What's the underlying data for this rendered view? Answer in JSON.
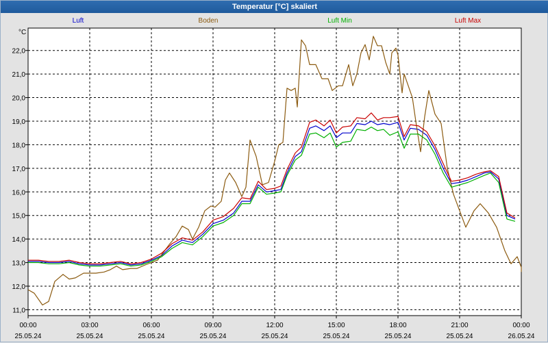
{
  "window": {
    "title": "Temperatur [°C] skaliert"
  },
  "colors": {
    "luft": "#0000cc",
    "boden": "#8b5a0f",
    "luft_min": "#00b000",
    "luft_max": "#c80000",
    "plot_bg": "#ffffff",
    "grid": "#000000"
  },
  "chart_data": {
    "type": "line",
    "title": "Temperatur [°C] skaliert",
    "ylabel": "°C",
    "xlabel": "",
    "ylim": [
      10.75,
      22.95
    ],
    "xlim_hours": [
      0,
      24
    ],
    "grid": true,
    "legend_placement": "top",
    "y_ticks": [
      "11,0",
      "12,0",
      "13,0",
      "14,0",
      "15,0",
      "16,0",
      "17,0",
      "18,0",
      "19,0",
      "20,0",
      "21,0",
      "22,0"
    ],
    "y_tick_values": [
      11,
      12,
      13,
      14,
      15,
      16,
      17,
      18,
      19,
      20,
      21,
      22
    ],
    "x_ticks": [
      {
        "time": "00:00",
        "date": "25.05.24",
        "hour": 0
      },
      {
        "time": "03:00",
        "date": "25.05.24",
        "hour": 3
      },
      {
        "time": "06:00",
        "date": "25.05.24",
        "hour": 6
      },
      {
        "time": "09:00",
        "date": "25.05.24",
        "hour": 9
      },
      {
        "time": "12:00",
        "date": "25.05.24",
        "hour": 12
      },
      {
        "time": "15:00",
        "date": "25.05.24",
        "hour": 15
      },
      {
        "time": "18:00",
        "date": "25.05.24",
        "hour": 18
      },
      {
        "time": "21:00",
        "date": "25.05.24",
        "hour": 21
      },
      {
        "time": "00:00",
        "date": "26.05.24",
        "hour": 24
      }
    ],
    "series": [
      {
        "name": "Luft",
        "color": "#0000cc",
        "points": [
          [
            0,
            13.05
          ],
          [
            0.5,
            13.05
          ],
          [
            1,
            13.0
          ],
          [
            1.5,
            13.0
          ],
          [
            2,
            13.05
          ],
          [
            2.5,
            12.95
          ],
          [
            3,
            12.9
          ],
          [
            3.5,
            12.9
          ],
          [
            4,
            12.95
          ],
          [
            4.5,
            13.0
          ],
          [
            5,
            12.9
          ],
          [
            5.5,
            12.95
          ],
          [
            6,
            13.1
          ],
          [
            6.5,
            13.3
          ],
          [
            7,
            13.7
          ],
          [
            7.5,
            13.95
          ],
          [
            8,
            13.85
          ],
          [
            8.5,
            14.2
          ],
          [
            9,
            14.65
          ],
          [
            9.5,
            14.8
          ],
          [
            10,
            15.1
          ],
          [
            10.4,
            15.6
          ],
          [
            10.8,
            15.6
          ],
          [
            11.2,
            16.3
          ],
          [
            11.6,
            16.0
          ],
          [
            12,
            16.05
          ],
          [
            12.3,
            16.1
          ],
          [
            12.6,
            16.8
          ],
          [
            13,
            17.5
          ],
          [
            13.3,
            17.7
          ],
          [
            13.7,
            18.7
          ],
          [
            14,
            18.8
          ],
          [
            14.4,
            18.6
          ],
          [
            14.7,
            18.8
          ],
          [
            15,
            18.3
          ],
          [
            15.3,
            18.5
          ],
          [
            15.7,
            18.5
          ],
          [
            16,
            18.9
          ],
          [
            16.4,
            18.85
          ],
          [
            16.7,
            19.0
          ],
          [
            17,
            18.85
          ],
          [
            17.3,
            18.9
          ],
          [
            17.6,
            18.85
          ],
          [
            18,
            18.95
          ],
          [
            18.3,
            18.2
          ],
          [
            18.6,
            18.7
          ],
          [
            19,
            18.65
          ],
          [
            19.4,
            18.4
          ],
          [
            19.8,
            17.8
          ],
          [
            20.2,
            17.0
          ],
          [
            20.6,
            16.35
          ],
          [
            21,
            16.4
          ],
          [
            21.4,
            16.5
          ],
          [
            21.8,
            16.65
          ],
          [
            22.2,
            16.8
          ],
          [
            22.5,
            16.85
          ],
          [
            22.9,
            16.55
          ],
          [
            23.3,
            15.0
          ],
          [
            23.7,
            14.85
          ]
        ]
      },
      {
        "name": "Boden",
        "color": "#8b5a0f",
        "points": [
          [
            0,
            11.85
          ],
          [
            0.3,
            11.7
          ],
          [
            0.7,
            11.2
          ],
          [
            1,
            11.35
          ],
          [
            1.3,
            12.2
          ],
          [
            1.7,
            12.5
          ],
          [
            2,
            12.3
          ],
          [
            2.3,
            12.35
          ],
          [
            2.7,
            12.55
          ],
          [
            3,
            12.55
          ],
          [
            3.3,
            12.55
          ],
          [
            3.7,
            12.6
          ],
          [
            4,
            12.7
          ],
          [
            4.3,
            12.85
          ],
          [
            4.6,
            12.7
          ],
          [
            5,
            12.75
          ],
          [
            5.3,
            12.75
          ],
          [
            5.7,
            12.9
          ],
          [
            6,
            13.0
          ],
          [
            6.3,
            13.1
          ],
          [
            6.6,
            13.45
          ],
          [
            6.9,
            13.8
          ],
          [
            7.2,
            14.1
          ],
          [
            7.5,
            14.55
          ],
          [
            7.8,
            14.4
          ],
          [
            8,
            14.0
          ],
          [
            8.3,
            14.5
          ],
          [
            8.6,
            15.2
          ],
          [
            8.9,
            15.4
          ],
          [
            9.1,
            15.35
          ],
          [
            9.4,
            15.6
          ],
          [
            9.6,
            16.5
          ],
          [
            9.8,
            16.8
          ],
          [
            10.1,
            16.4
          ],
          [
            10.4,
            15.8
          ],
          [
            10.6,
            16.2
          ],
          [
            10.8,
            18.2
          ],
          [
            11.1,
            17.5
          ],
          [
            11.4,
            16.3
          ],
          [
            11.7,
            16.4
          ],
          [
            12,
            17.3
          ],
          [
            12.2,
            18.0
          ],
          [
            12.4,
            18.1
          ],
          [
            12.6,
            20.4
          ],
          [
            12.8,
            20.3
          ],
          [
            13.0,
            20.4
          ],
          [
            13.1,
            19.6
          ],
          [
            13.3,
            22.45
          ],
          [
            13.5,
            22.2
          ],
          [
            13.7,
            21.4
          ],
          [
            14,
            21.4
          ],
          [
            14.3,
            20.8
          ],
          [
            14.6,
            20.8
          ],
          [
            14.8,
            20.3
          ],
          [
            15.1,
            20.5
          ],
          [
            15.3,
            20.5
          ],
          [
            15.6,
            21.4
          ],
          [
            15.8,
            20.5
          ],
          [
            16.0,
            21.0
          ],
          [
            16.2,
            21.9
          ],
          [
            16.4,
            22.25
          ],
          [
            16.6,
            21.6
          ],
          [
            16.8,
            22.6
          ],
          [
            17,
            22.2
          ],
          [
            17.2,
            22.2
          ],
          [
            17.4,
            21.5
          ],
          [
            17.6,
            21.0
          ],
          [
            17.7,
            21.9
          ],
          [
            17.9,
            22.1
          ],
          [
            18,
            21.8
          ],
          [
            18.2,
            20.2
          ],
          [
            18.3,
            21.0
          ],
          [
            18.5,
            20.5
          ],
          [
            18.7,
            20.0
          ],
          [
            18.9,
            18.8
          ],
          [
            19.1,
            17.7
          ],
          [
            19.3,
            19.2
          ],
          [
            19.5,
            20.3
          ],
          [
            19.8,
            19.3
          ],
          [
            20.1,
            18.9
          ],
          [
            20.4,
            17.0
          ],
          [
            20.7,
            15.9
          ],
          [
            21,
            15.2
          ],
          [
            21.3,
            14.5
          ],
          [
            21.7,
            15.2
          ],
          [
            22.0,
            15.5
          ],
          [
            22.4,
            15.1
          ],
          [
            22.8,
            14.5
          ],
          [
            23.2,
            13.5
          ],
          [
            23.5,
            12.95
          ],
          [
            23.8,
            13.25
          ],
          [
            24.1,
            12.8
          ],
          [
            24.4,
            12.6
          ]
        ]
      },
      {
        "name": "Luft Min",
        "color": "#00b000",
        "points": [
          [
            0,
            13.0
          ],
          [
            0.5,
            13.0
          ],
          [
            1,
            12.95
          ],
          [
            1.5,
            12.95
          ],
          [
            2,
            13.0
          ],
          [
            2.5,
            12.9
          ],
          [
            3,
            12.85
          ],
          [
            3.5,
            12.85
          ],
          [
            4,
            12.9
          ],
          [
            4.5,
            12.95
          ],
          [
            5,
            12.85
          ],
          [
            5.5,
            12.9
          ],
          [
            6,
            13.05
          ],
          [
            6.5,
            13.25
          ],
          [
            7,
            13.6
          ],
          [
            7.5,
            13.85
          ],
          [
            8,
            13.75
          ],
          [
            8.5,
            14.1
          ],
          [
            9,
            14.55
          ],
          [
            9.5,
            14.7
          ],
          [
            10,
            15.0
          ],
          [
            10.4,
            15.5
          ],
          [
            10.8,
            15.5
          ],
          [
            11.2,
            16.2
          ],
          [
            11.6,
            15.9
          ],
          [
            12,
            15.95
          ],
          [
            12.3,
            16.0
          ],
          [
            12.6,
            16.7
          ],
          [
            13,
            17.35
          ],
          [
            13.3,
            17.55
          ],
          [
            13.7,
            18.45
          ],
          [
            14,
            18.5
          ],
          [
            14.4,
            18.3
          ],
          [
            14.7,
            18.5
          ],
          [
            15,
            17.9
          ],
          [
            15.3,
            18.1
          ],
          [
            15.7,
            18.15
          ],
          [
            16,
            18.65
          ],
          [
            16.4,
            18.6
          ],
          [
            16.7,
            18.75
          ],
          [
            17,
            18.6
          ],
          [
            17.3,
            18.65
          ],
          [
            17.6,
            18.4
          ],
          [
            18,
            18.55
          ],
          [
            18.3,
            17.85
          ],
          [
            18.6,
            18.45
          ],
          [
            19,
            18.45
          ],
          [
            19.4,
            18.2
          ],
          [
            19.8,
            17.6
          ],
          [
            20.2,
            16.8
          ],
          [
            20.6,
            16.2
          ],
          [
            21,
            16.3
          ],
          [
            21.4,
            16.4
          ],
          [
            21.8,
            16.55
          ],
          [
            22.2,
            16.7
          ],
          [
            22.5,
            16.8
          ],
          [
            22.9,
            16.4
          ],
          [
            23.3,
            14.85
          ],
          [
            23.7,
            14.75
          ]
        ]
      },
      {
        "name": "Luft Max",
        "color": "#c80000",
        "points": [
          [
            0,
            13.1
          ],
          [
            0.5,
            13.1
          ],
          [
            1,
            13.05
          ],
          [
            1.5,
            13.05
          ],
          [
            2,
            13.1
          ],
          [
            2.5,
            13.0
          ],
          [
            3,
            12.95
          ],
          [
            3.5,
            12.95
          ],
          [
            4,
            13.0
          ],
          [
            4.5,
            13.05
          ],
          [
            5,
            12.95
          ],
          [
            5.5,
            13.0
          ],
          [
            6,
            13.15
          ],
          [
            6.5,
            13.4
          ],
          [
            7,
            13.8
          ],
          [
            7.5,
            14.05
          ],
          [
            8,
            13.95
          ],
          [
            8.5,
            14.3
          ],
          [
            9,
            14.8
          ],
          [
            9.5,
            14.95
          ],
          [
            10,
            15.3
          ],
          [
            10.4,
            15.75
          ],
          [
            10.8,
            15.7
          ],
          [
            11.2,
            16.45
          ],
          [
            11.6,
            16.1
          ],
          [
            12,
            16.15
          ],
          [
            12.3,
            16.25
          ],
          [
            12.6,
            16.95
          ],
          [
            13,
            17.65
          ],
          [
            13.3,
            17.9
          ],
          [
            13.7,
            18.95
          ],
          [
            14,
            19.05
          ],
          [
            14.4,
            18.8
          ],
          [
            14.7,
            19.05
          ],
          [
            15,
            18.5
          ],
          [
            15.3,
            18.75
          ],
          [
            15.7,
            18.8
          ],
          [
            16,
            19.15
          ],
          [
            16.4,
            19.1
          ],
          [
            16.7,
            19.35
          ],
          [
            17,
            19.05
          ],
          [
            17.3,
            19.15
          ],
          [
            17.6,
            19.15
          ],
          [
            18,
            19.2
          ],
          [
            18.3,
            18.35
          ],
          [
            18.6,
            18.85
          ],
          [
            19,
            18.8
          ],
          [
            19.4,
            18.55
          ],
          [
            19.8,
            17.95
          ],
          [
            20.2,
            17.2
          ],
          [
            20.6,
            16.45
          ],
          [
            21,
            16.5
          ],
          [
            21.4,
            16.6
          ],
          [
            21.8,
            16.75
          ],
          [
            22.2,
            16.85
          ],
          [
            22.5,
            16.9
          ],
          [
            22.9,
            16.65
          ],
          [
            23.3,
            15.1
          ],
          [
            23.7,
            14.9
          ]
        ]
      }
    ]
  }
}
